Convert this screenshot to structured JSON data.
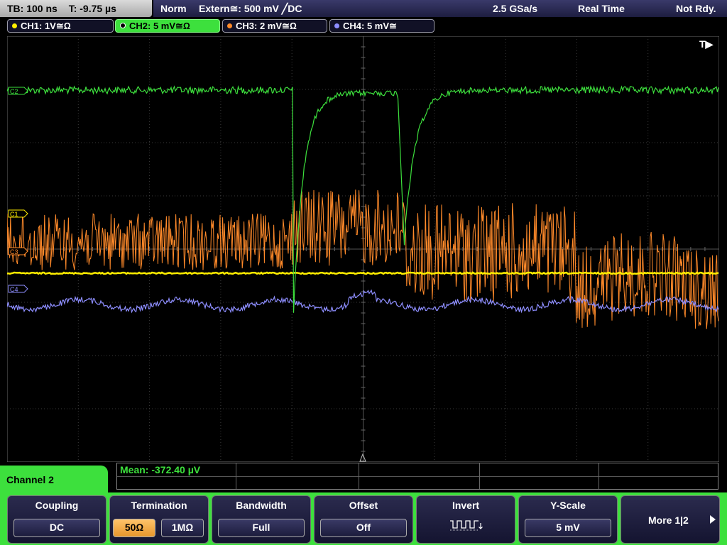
{
  "status_bar": {
    "timebase": "TB: 100 ns",
    "trigger_time": "T: -9.75 µs",
    "trigger_mode": "Norm",
    "trigger_source": "Extern≅: 500 mV ╱DC",
    "sample_rate": "2.5 GSa/s",
    "acq_mode": "Real Time",
    "run_state": "Not Rdy."
  },
  "channels": [
    {
      "label": "CH1: 1V≅Ω",
      "color": "#ffee00",
      "active": false
    },
    {
      "label": "CH2: 5 mV≅Ω",
      "color": "#3de03d",
      "active": true
    },
    {
      "label": "CH3: 2 mV≅Ω",
      "color": "#ff8a2a",
      "active": false
    },
    {
      "label": "CH4: 5 mV≅",
      "color": "#8e8eff",
      "active": false
    }
  ],
  "waveform_markers": {
    "c1": "C1",
    "c2": "C2",
    "c3": "C3",
    "c4": "C4",
    "trigger_marker": "T▶"
  },
  "measurement": {
    "mean_text": "Mean: -372.40 µV"
  },
  "menu": {
    "title": "Channel 2",
    "softkeys": [
      {
        "label": "Coupling",
        "value": "DC"
      },
      {
        "label": "Termination",
        "options": [
          "50Ω",
          "1MΩ"
        ],
        "selected": "50Ω"
      },
      {
        "label": "Bandwidth",
        "value": "Full"
      },
      {
        "label": "Offset",
        "value": "Off"
      },
      {
        "label": "Invert",
        "icon": "invert-waveform-icon"
      },
      {
        "label": "Y-Scale",
        "value": "5 mV"
      }
    ],
    "more": "More 1|2",
    "more_icon": "arrow-right-icon"
  },
  "colors": {
    "ch1": "#ffee00",
    "ch2": "#3de03d",
    "ch3": "#ff8a2a",
    "ch4": "#8e8eff",
    "grid": "#3a3a3a"
  }
}
